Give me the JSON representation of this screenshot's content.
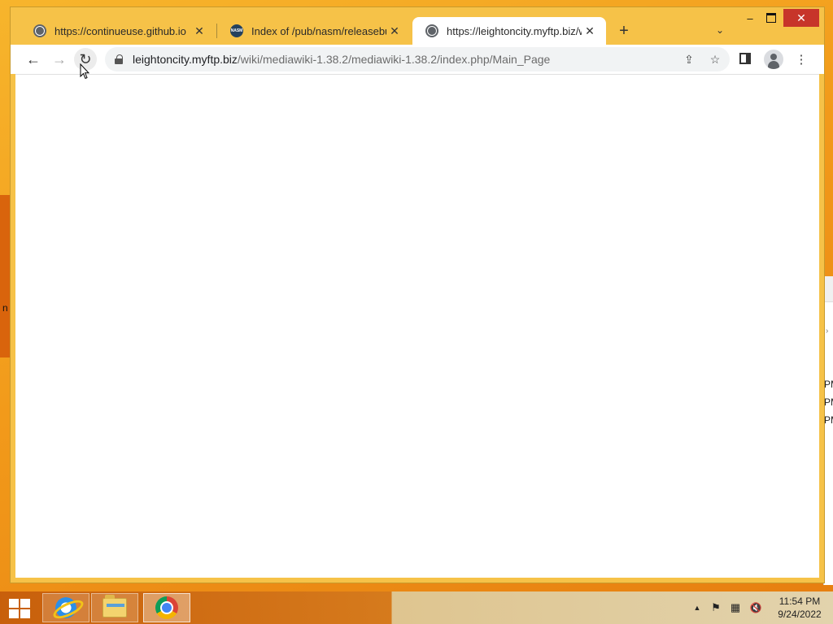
{
  "browser": {
    "tabs": [
      {
        "title": "https://continueuse.github.io",
        "favicon": "globe-icon",
        "active": false
      },
      {
        "title": "Index of /pub/nasm/releasebuild",
        "favicon": "nasm-icon",
        "active": false
      },
      {
        "title": "https://leightoncity.myftp.biz/wik",
        "favicon": "globe-icon",
        "active": true
      }
    ],
    "new_tab_symbol": "+",
    "tab_search_symbol": "⌄",
    "window_controls": {
      "minimize": "–",
      "close": "✕"
    },
    "address": {
      "host": "leightoncity.myftp.biz",
      "path": "/wiki/mediawiki-1.38.2/mediawiki-1.38.2/index.php/Main_Page"
    },
    "nav": {
      "back": "←",
      "forward": "→",
      "reload": "↻"
    },
    "toolbar_icons": {
      "share": "⇪",
      "bookmark": "☆",
      "menu": "⋮"
    }
  },
  "desktop": {
    "left_fragment": "n",
    "right_window_rows": [
      "PM",
      "PM",
      "PM"
    ]
  },
  "taskbar": {
    "apps": [
      {
        "name": "Internet Explorer",
        "icon": "internet-explorer-icon"
      },
      {
        "name": "File Explorer",
        "icon": "folder-icon"
      },
      {
        "name": "Google Chrome",
        "icon": "chrome-icon",
        "active": true
      }
    ],
    "tray": {
      "expand": "▲",
      "flag": "⚑",
      "network": "▦",
      "volume": "🔇"
    },
    "clock": {
      "time": "11:54 PM",
      "date": "9/24/2022"
    }
  },
  "colors": {
    "titlebar": "#f6c248",
    "close_button": "#c7352a",
    "desktop": "#f29a1a"
  }
}
